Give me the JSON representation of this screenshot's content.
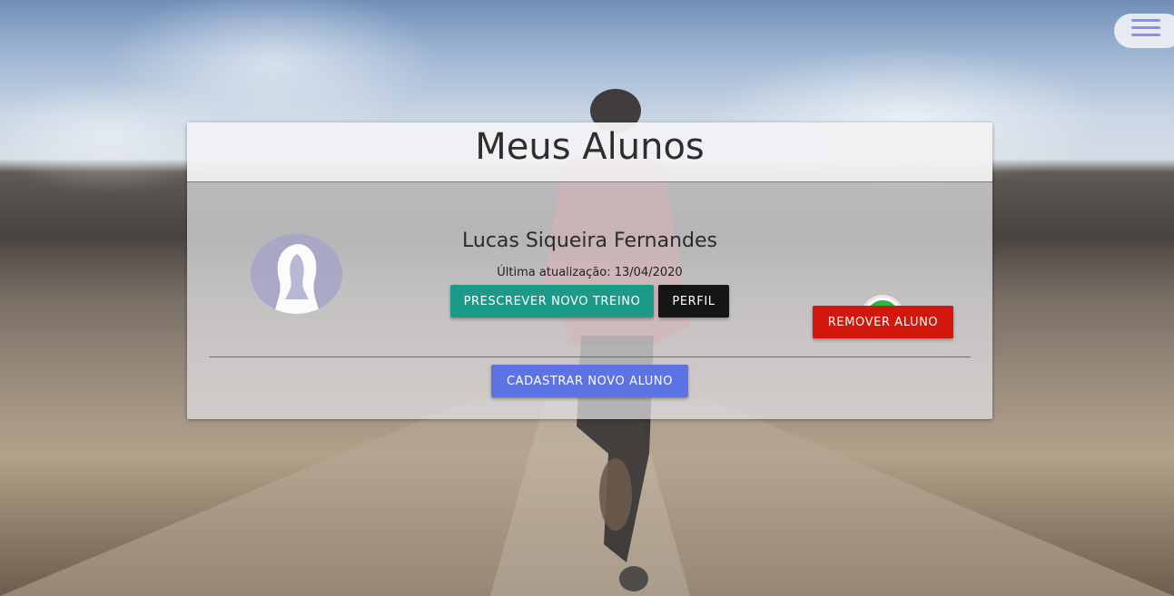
{
  "page": {
    "title": "Meus Alunos"
  },
  "menu": {
    "icon": "hamburger-menu-icon",
    "accent_color": "#8a8ef0"
  },
  "students": [
    {
      "name": "Lucas Siqueira Fernandes",
      "last_update": "Última atualização: 13/04/2020",
      "avatar_icon": "user-silhouette-icon",
      "actions": {
        "prescribe_label": "PRESCREVER NOVO TREINO",
        "profile_label": "PERFIL",
        "remove_label": "REMOVER ALUNO",
        "whatsapp_icon": "whatsapp-icon"
      }
    }
  ],
  "footer": {
    "register_label": "CADASTRAR NOVO ALUNO"
  },
  "colors": {
    "prescribe": "#1c9a88",
    "profile": "#151515",
    "remove": "#d2170c",
    "register": "#5d72e3",
    "whatsapp": "#2cb742"
  }
}
